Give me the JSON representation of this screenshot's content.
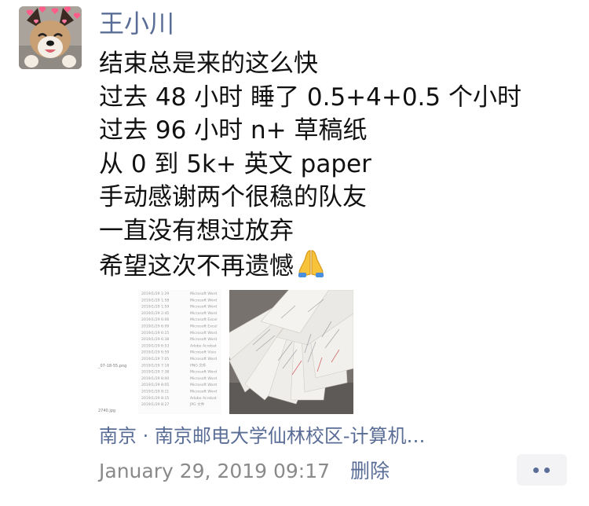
{
  "post": {
    "username": "王小川",
    "lines": [
      "结束总是来的这么快",
      "过去 48 小时  睡了 0.5+4+0.5 个小时",
      "过去 96 小时  n+ 草稿纸",
      "从 0 到 5k+ 英文 paper",
      "手动感谢两个很稳的队友",
      "一直没有想过放弃",
      "希望这次不再遗憾"
    ],
    "emoji": "folded-hands-icon",
    "images": [
      {
        "name": "file-list-screenshot",
        "left_labels": [
          "_07-18-55.png",
          "2740.jpg"
        ],
        "rows": [
          {
            "date": "2019/1/29 1:29",
            "type": "Microsoft Word"
          },
          {
            "date": "2019/1/29 1:58",
            "type": "Microsoft Word"
          },
          {
            "date": "2019/1/29 1:59",
            "type": "Microsoft Word"
          },
          {
            "date": "2019/1/29 2:45",
            "type": "Microsoft Word"
          },
          {
            "date": "2019/1/29 6:06",
            "type": "Microsoft Excel"
          },
          {
            "date": "2019/1/29 6:09",
            "type": "Microsoft Excel"
          },
          {
            "date": "2019/1/29 6:15",
            "type": "Microsoft Word"
          },
          {
            "date": "2019/1/29 6:38",
            "type": "Microsoft Word"
          },
          {
            "date": "2019/1/29 6:53",
            "type": "Adobe Acrobat"
          },
          {
            "date": "2019/1/29 6:59",
            "type": "Microsoft Visio"
          },
          {
            "date": "2019/1/29 7:05",
            "type": "Microsoft Word"
          },
          {
            "date": "2019/1/29 7:18",
            "type": "PNG 文件"
          },
          {
            "date": "2019/1/29 7:38",
            "type": "Microsoft Word"
          },
          {
            "date": "2019/1/29 8:00",
            "type": "Microsoft Word"
          },
          {
            "date": "2019/1/29 8:05",
            "type": "Microsoft Word"
          },
          {
            "date": "2019/1/29 8:11",
            "type": "Microsoft Word"
          },
          {
            "date": "2019/1/29 8:15",
            "type": "Adobe Acrobat"
          },
          {
            "date": "2019/1/29 8:27",
            "type": "JPG 文件"
          }
        ]
      },
      {
        "name": "scratch-paper-photo"
      }
    ],
    "location": "南京 · 南京邮电大学仙林校区-计算机…",
    "timestamp": "January 29, 2019 09:17",
    "delete_label": "删除",
    "more_icon": "more-dots-icon"
  },
  "colors": {
    "link": "#5a6d96",
    "meta": "#8a8a8a",
    "text": "#111111"
  }
}
